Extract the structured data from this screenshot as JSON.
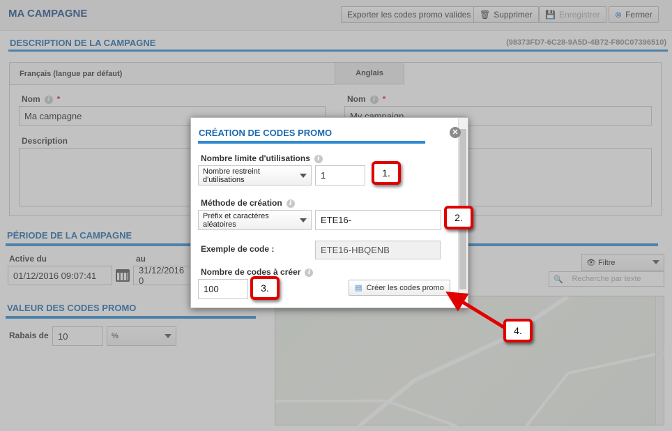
{
  "header": {
    "title": "MA CAMPAGNE",
    "buttons": {
      "export": "Exporter les codes promo valides",
      "delete": "Supprimer",
      "save": "Enregistrer",
      "close": "Fermer"
    }
  },
  "description": {
    "title": "DESCRIPTION DE LA CAMPAGNE",
    "guid": "(98373FD7-6C28-9A5D-4B72-F80C07396510)",
    "tab_fr": "Français (langue par défaut)",
    "tab_en": "Anglais",
    "name_label": "Nom",
    "name_fr": "Ma campagne",
    "name_en": "My campaign",
    "desc_label": "Description"
  },
  "period": {
    "title": "PÉRIODE DE LA CAMPAGNE",
    "active_label": "Active du",
    "to_label": "au",
    "start": "01/12/2016 09:07:41",
    "end": "31/12/2016 0"
  },
  "value": {
    "title": "VALEUR DES CODES PROMO",
    "discount_label": "Rabais de",
    "discount_value": "10",
    "unit": "%"
  },
  "filter": {
    "label": "Filtre",
    "search_placeholder": "Recherche par texte"
  },
  "modal": {
    "title": "CRÉATION DE CODES PROMO",
    "limit_label": "Nombre limite d'utilisations",
    "limit_select": "Nombre restreint d'utilisations",
    "limit_value": "1",
    "method_label": "Méthode de création",
    "method_select": "Préfix et caractères aléatoires",
    "prefix_value": "ETE16-",
    "example_label": "Exemple de code :",
    "example_value": "ETE16-HBQENB",
    "count_label": "Nombre de codes à créer",
    "count_value": "100",
    "create_button": "Créer les codes promo"
  },
  "callouts": [
    "1.",
    "2.",
    "3.",
    "4."
  ],
  "colors": {
    "accent": "#2f8bd2",
    "title": "#1b6ab0",
    "callout": "#e00000"
  }
}
